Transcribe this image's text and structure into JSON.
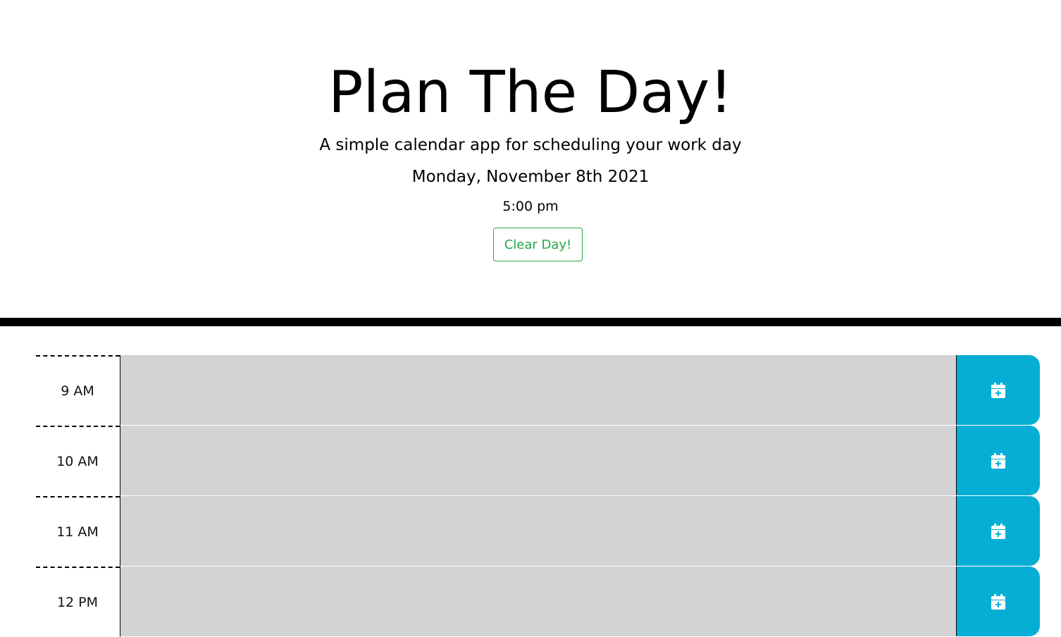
{
  "header": {
    "title": "Plan The Day!",
    "subtitle": "A simple calendar app for scheduling your work day",
    "current_date": "Monday, November 8th 2021",
    "current_time": "5:00 pm",
    "clear_button_label": "Clear Day!"
  },
  "planner": {
    "rows": [
      {
        "hour": "9 AM",
        "description": "",
        "save_icon": "calendar-plus-icon"
      },
      {
        "hour": "10 AM",
        "description": "",
        "save_icon": "calendar-plus-icon"
      },
      {
        "hour": "11 AM",
        "description": "",
        "save_icon": "calendar-plus-icon"
      },
      {
        "hour": "12 PM",
        "description": "",
        "save_icon": "calendar-plus-icon"
      }
    ]
  },
  "colors": {
    "past_block": "#d3d3d3",
    "save_button": "#06aed5",
    "clear_button": "#28a745",
    "divider": "#000000"
  }
}
